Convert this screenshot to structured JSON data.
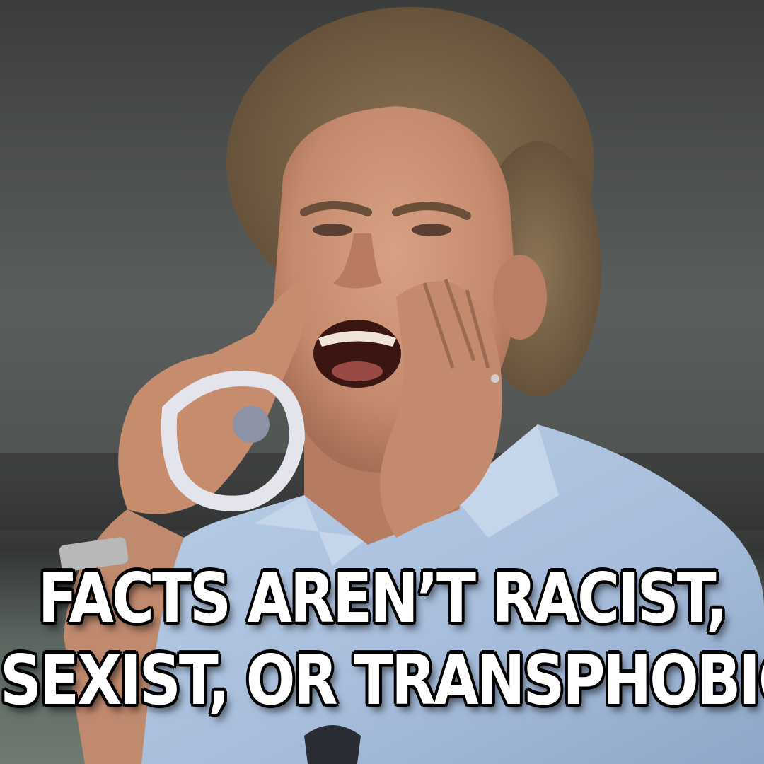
{
  "meme": {
    "caption_line_1": "FACTS AREN’T RACIST,",
    "caption_line_2": "SEXIST, OR TRANSPHOBIC!"
  },
  "colors": {
    "background_top": "#3b3d3c",
    "background_mid": "#5a5e5c",
    "shirt": "#a9bfdb",
    "skin": "#c98f74",
    "hair": "#7b6448",
    "caption_fill": "#ffffff",
    "caption_outline": "#000000"
  },
  "icons": {
    "photo": "man-shouting-hands-cupped-photo"
  }
}
